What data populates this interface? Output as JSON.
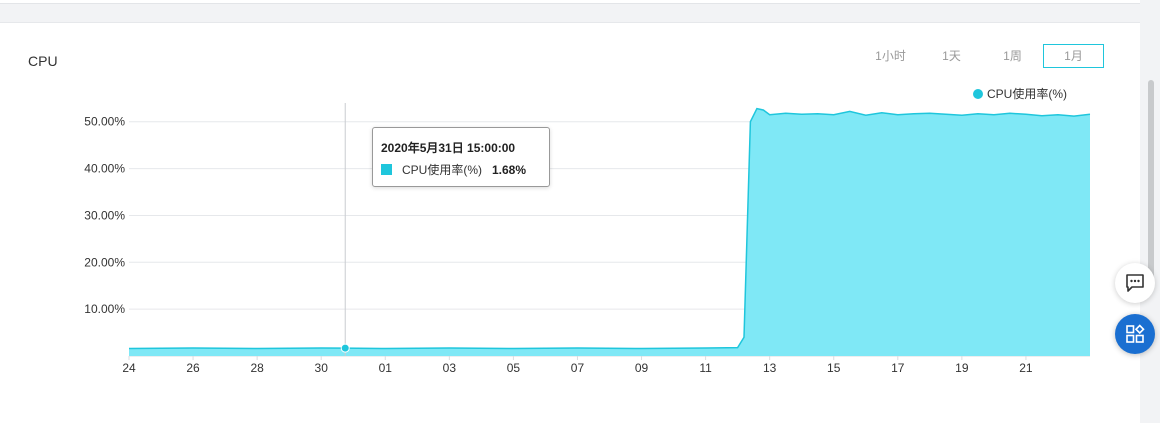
{
  "panel": {
    "title": "CPU",
    "range_tabs": [
      {
        "label": "1小时",
        "active": false
      },
      {
        "label": "1天",
        "active": false
      },
      {
        "label": "1周",
        "active": false
      },
      {
        "label": "1月",
        "active": true
      }
    ]
  },
  "tooltip": {
    "title": "2020年5月31日 15:00:00",
    "series": "CPU使用率(%)",
    "value": "1.68%"
  },
  "colors": {
    "series": "#1fc6dc",
    "fill": "#7fe8f6",
    "grid": "#e6e8eb",
    "active_tab_border": "#1fc6dc",
    "fab_blue": "#1a6fd1"
  },
  "icons": {
    "chat": "chat-bubble-icon",
    "apps": "apps-grid-icon"
  },
  "chart_data": {
    "type": "area",
    "legend": "CPU使用率(%)",
    "legend_position": "top-right",
    "grid": true,
    "y_ticks": [
      "10.00%",
      "20.00%",
      "30.00%",
      "40.00%",
      "50.00%"
    ],
    "x_ticks": [
      "24",
      "26",
      "28",
      "30",
      "01",
      "03",
      "05",
      "07",
      "09",
      "11",
      "13",
      "15",
      "17",
      "19",
      "21"
    ],
    "x_range_days": [
      0,
      30
    ],
    "ylim": [
      0,
      54
    ],
    "series": [
      {
        "name": "CPU使用率(%)",
        "x": [
          0,
          2,
          4,
          6,
          6.75,
          8,
          10,
          12,
          14,
          16,
          18,
          19,
          19.2,
          19.4,
          19.6,
          19.8,
          20,
          20.5,
          21,
          21.5,
          22,
          22.5,
          23,
          23.5,
          24,
          24.5,
          25,
          25.5,
          26,
          26.5,
          27,
          27.5,
          28,
          28.5,
          29,
          29.5,
          30
        ],
        "y": [
          1.6,
          1.7,
          1.6,
          1.7,
          1.68,
          1.6,
          1.7,
          1.6,
          1.7,
          1.6,
          1.7,
          1.8,
          4,
          50,
          52.8,
          52.5,
          51.5,
          51.8,
          51.6,
          51.7,
          51.5,
          52.2,
          51.4,
          51.9,
          51.5,
          51.7,
          51.8,
          51.6,
          51.4,
          51.7,
          51.5,
          51.8,
          51.6,
          51.3,
          51.5,
          51.2,
          51.6
        ]
      }
    ],
    "highlight": {
      "x": 6.75,
      "label": "2020年5月31日 15:00:00",
      "value": 1.68
    }
  }
}
